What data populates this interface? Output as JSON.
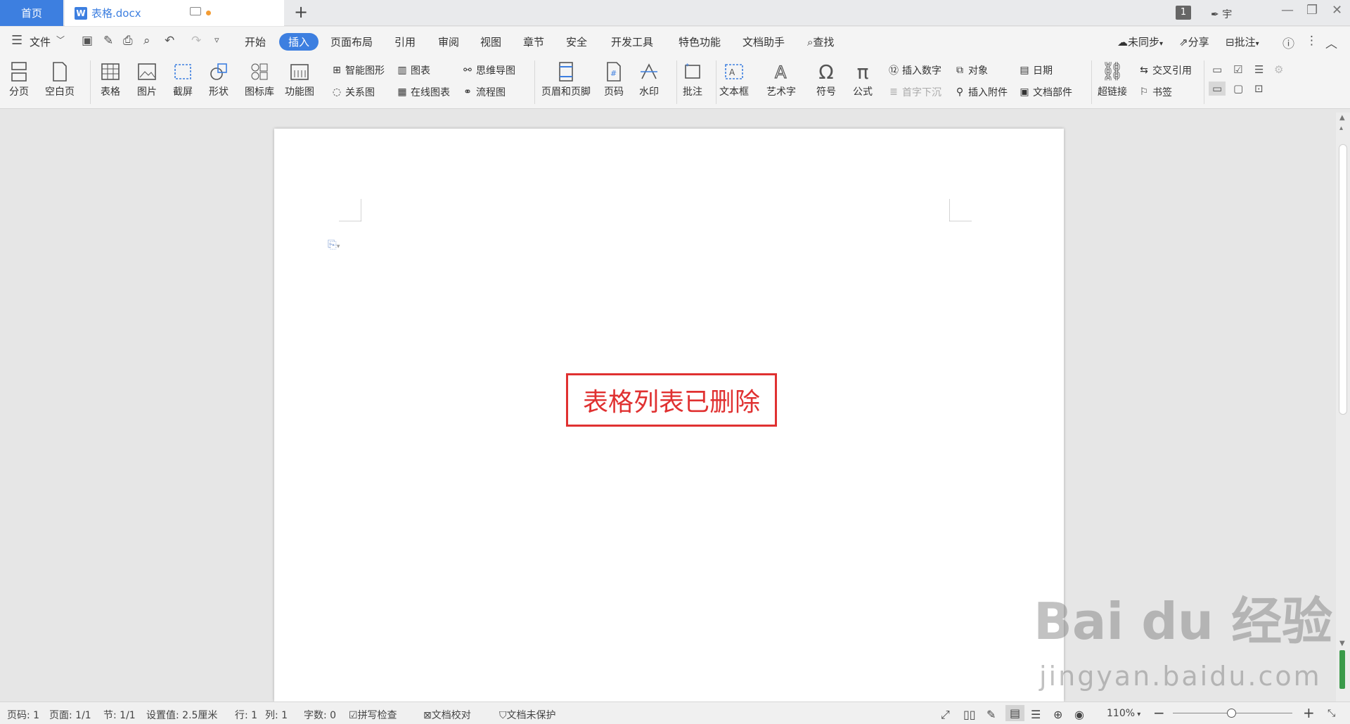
{
  "tabs": {
    "home": "首页",
    "doc_name": "表格.docx"
  },
  "window": {
    "page_indicator": "1",
    "user": "宇"
  },
  "menu": {
    "file": "文件",
    "items": [
      "开始",
      "插入",
      "页面布局",
      "引用",
      "审阅",
      "视图",
      "章节",
      "安全",
      "开发工具",
      "特色功能",
      "文档助手"
    ],
    "active": "插入",
    "search": "查找",
    "sync": "未同步",
    "share": "分享",
    "comment": "批注"
  },
  "ribbon": {
    "page_break": "分页",
    "blank_page": "空白页",
    "table": "表格",
    "picture": "图片",
    "screenshot": "截屏",
    "shape": "形状",
    "icon_lib": "图标库",
    "func_chart": "功能图",
    "smart_shape": "智能图形",
    "relation": "关系图",
    "chart": "图表",
    "online_chart": "在线图表",
    "mind_map": "思维导图",
    "flowchart": "流程图",
    "header_footer": "页眉和页脚",
    "page_num": "页码",
    "watermark": "水印",
    "comment": "批注",
    "textbox": "文本框",
    "wordart": "艺术字",
    "symbol": "符号",
    "formula": "公式",
    "insert_number": "插入数字",
    "drop_cap": "首字下沉",
    "object": "对象",
    "attachment": "插入附件",
    "date": "日期",
    "doc_parts": "文档部件",
    "hyperlink": "超链接",
    "cross_ref": "交叉引用",
    "bookmark": "书签"
  },
  "document": {
    "notice": "表格列表已删除"
  },
  "status": {
    "page": "页码: 1",
    "pages": "页面: 1/1",
    "section": "节: 1/1",
    "setting": "设置值: 2.5厘米",
    "row": "行: 1",
    "col": "列: 1",
    "words": "字数: 0",
    "spell": "拼写检查",
    "proof": "文档校对",
    "protect": "文档未保护",
    "zoom": "110%"
  },
  "watermark": {
    "brand": "Bai du 经验",
    "url": "jingyan.baidu.com"
  }
}
